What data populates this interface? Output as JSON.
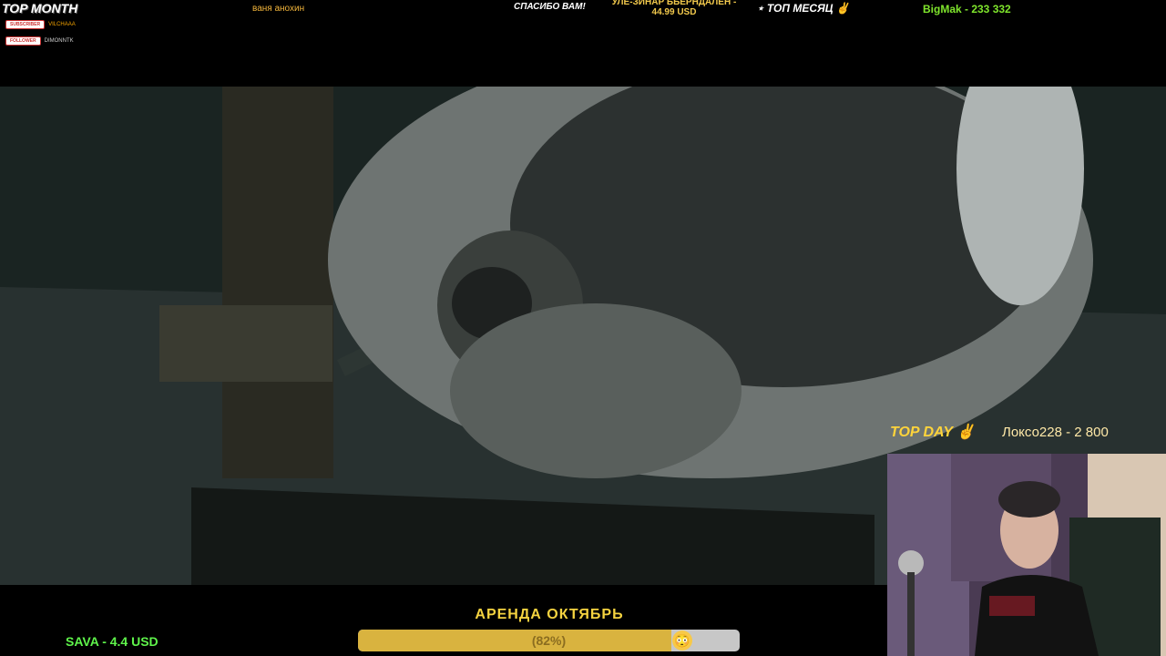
{
  "top_bar": {
    "top_month_label": "TOP MONTH",
    "name": "ваня анохин",
    "thanks": "СПАСИБО ВАМ!",
    "donation_line1": "УЛЕ-ЗИНАР БЬЕРНДАЛЕН -",
    "donation_line2": "44.99 USD",
    "top_month_ru": "⋆ ТОП МЕСЯЦ ✌",
    "bigmak": "BigMak - 233 332"
  },
  "alerts": {
    "subscriber_badge": "SUBSCRIBER",
    "subscriber_name": "VILCHAAA",
    "follower_badge": "FOLLOWER",
    "follower_name": "DIMONNTK"
  },
  "top_day": {
    "label": "TOP DAY ✌",
    "value": "Локсо228 - 2 800"
  },
  "goal": {
    "title": "АРЕНДА ОКТЯБРЬ",
    "percent_label": "(82%)",
    "percent": 82,
    "emoji": "😳"
  },
  "donor": "SAVA - 4.4 USD"
}
